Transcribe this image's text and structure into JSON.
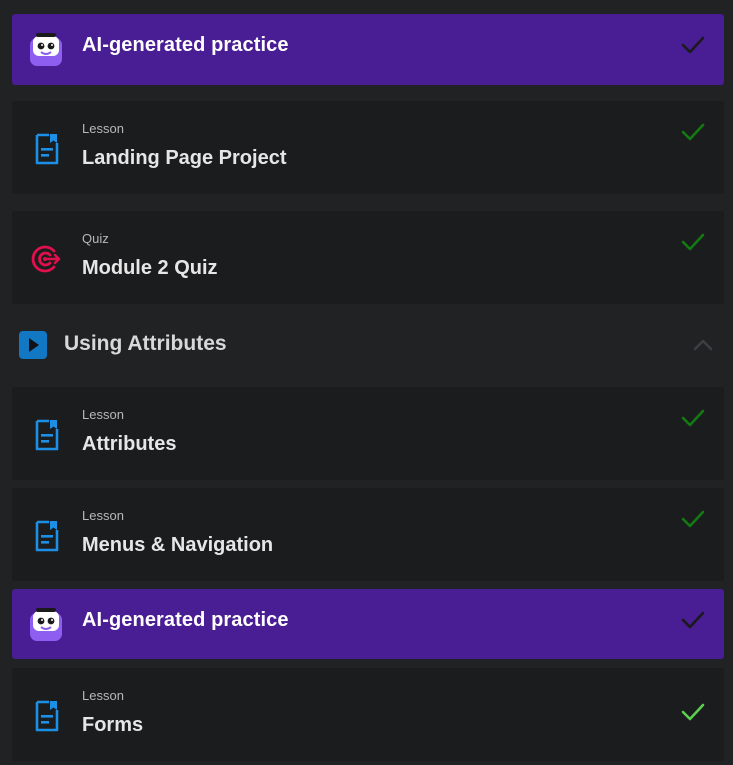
{
  "rows": [
    {
      "kind": "ai",
      "title": "AI-generated practice",
      "completed": true,
      "check_color": "#1a1a1a"
    },
    {
      "kind": "item",
      "type": "Lesson",
      "title": "Landing Page Project",
      "icon": "document-icon",
      "completed": true,
      "check_color": "#137a12"
    },
    {
      "kind": "item",
      "type": "Quiz",
      "title": "Module 2 Quiz",
      "icon": "target-icon",
      "completed": true,
      "check_color": "#137a12"
    }
  ],
  "section": {
    "title": "Using Attributes",
    "icon": "play-icon",
    "expanded": true
  },
  "section_rows": [
    {
      "kind": "item",
      "type": "Lesson",
      "title": "Attributes",
      "icon": "document-icon",
      "completed": true,
      "check_color": "#137a12"
    },
    {
      "kind": "item",
      "type": "Lesson",
      "title": "Menus & Navigation",
      "icon": "document-icon",
      "completed": true,
      "check_color": "#137a12"
    },
    {
      "kind": "ai",
      "title": "AI-generated practice",
      "completed": true,
      "check_color": "#1a1a1a"
    },
    {
      "kind": "item",
      "type": "Lesson",
      "title": "Forms",
      "icon": "document-icon",
      "completed": true,
      "check_color": "#5ccf4e"
    }
  ],
  "colors": {
    "ai_bg": "#491d94",
    "item_bg": "#1b1c1e",
    "page_bg": "#212224",
    "lesson_icon": "#1c8fe6",
    "quiz_icon": "#e0104c",
    "section_icon": "#1278c3"
  }
}
